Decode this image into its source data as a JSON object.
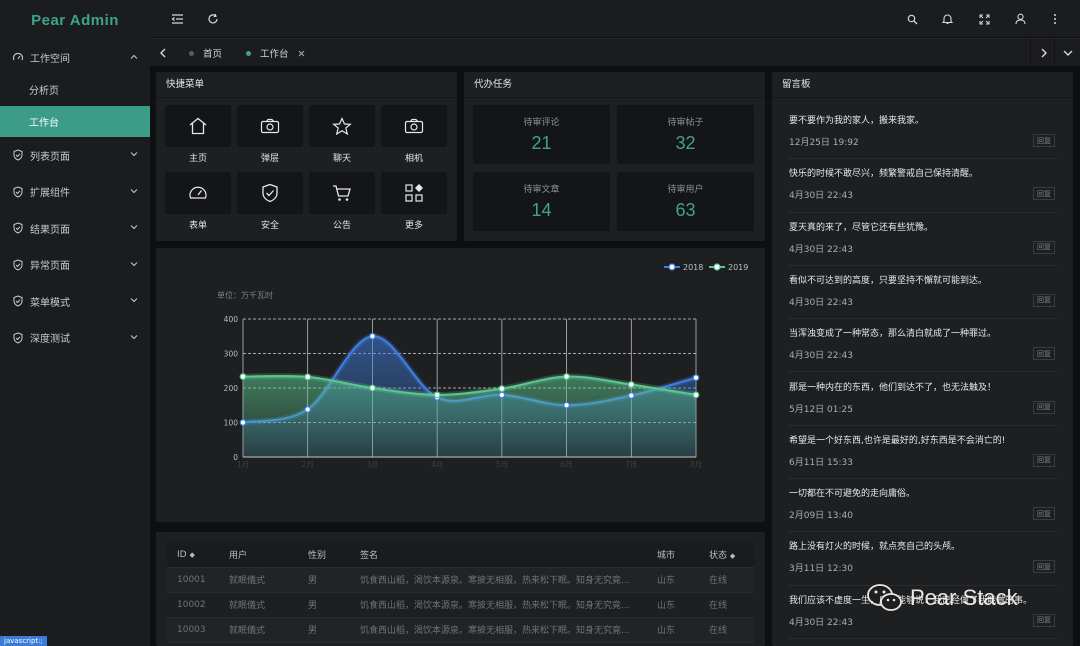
{
  "app": {
    "title": "Pear Admin"
  },
  "sidebar": {
    "items": [
      {
        "label": "工作空间",
        "icon": "dashboard-icon",
        "expanded": true
      },
      {
        "label": "分析页"
      },
      {
        "label": "工作台",
        "active": true
      },
      {
        "label": "列表页面",
        "icon": "shield-check-icon"
      },
      {
        "label": "扩展组件",
        "icon": "shield-check-icon"
      },
      {
        "label": "结果页面",
        "icon": "shield-check-icon"
      },
      {
        "label": "异常页面",
        "icon": "shield-check-icon"
      },
      {
        "label": "菜单模式",
        "icon": "shield-check-icon"
      },
      {
        "label": "深度测试",
        "icon": "shield-check-icon"
      }
    ]
  },
  "topbar": {
    "icons": [
      "menu-collapse-icon",
      "refresh-icon",
      "search-icon",
      "bell-icon",
      "fullscreen-icon",
      "user-icon",
      "more-icon"
    ]
  },
  "tabs": [
    {
      "label": "首页",
      "dot_color": "#5a5c60"
    },
    {
      "label": "工作台",
      "dot_color": "#3fa38c",
      "closable": true
    }
  ],
  "quick_menu": {
    "title": "快捷菜单",
    "items": [
      {
        "label": "主页",
        "icon": "home-icon"
      },
      {
        "label": "弹层",
        "icon": "camera-icon"
      },
      {
        "label": "聊天",
        "icon": "star-icon"
      },
      {
        "label": "相机",
        "icon": "camera-icon"
      },
      {
        "label": "表单",
        "icon": "gauge-icon"
      },
      {
        "label": "安全",
        "icon": "shield-check-icon"
      },
      {
        "label": "公告",
        "icon": "cart-icon"
      },
      {
        "label": "更多",
        "icon": "apps-icon"
      }
    ]
  },
  "todo": {
    "title": "代办任务",
    "items": [
      {
        "label": "待审评论",
        "value": "21"
      },
      {
        "label": "待审帖子",
        "value": "32"
      },
      {
        "label": "待审文章",
        "value": "14"
      },
      {
        "label": "待审用户",
        "value": "63"
      }
    ]
  },
  "messages": {
    "title": "留言板",
    "reply_label": "回复",
    "items": [
      {
        "text": "要不要作为我的家人，搬来我家。",
        "time": "12月25日 19:92"
      },
      {
        "text": "快乐的时候不敢尽兴，频繁警戒自己保持清醒。",
        "time": "4月30日 22:43"
      },
      {
        "text": "夏天真的来了，尽管它还有些犹豫。",
        "time": "4月30日 22:43"
      },
      {
        "text": "看似不可达到的高度，只要坚持不懈就可能到达。",
        "time": "4月30日 22:43"
      },
      {
        "text": "当浑浊变成了一种常态，那么清白就成了一种罪过。",
        "time": "4月30日 22:43"
      },
      {
        "text": "那是一种内在的东西，他们到达不了，也无法触及！",
        "time": "5月12日 01:25"
      },
      {
        "text": "希望是一个好东西,也许是最好的,好东西是不会消亡的!",
        "time": "6月11日 15:33"
      },
      {
        "text": "一切都在不可避免的走向庸俗。",
        "time": "2月09日 13:40"
      },
      {
        "text": "路上没有灯火的时候，就点亮自己的头颅。",
        "time": "3月11日 12:30"
      },
      {
        "text": "我们应该不虚度一生，应该能够说：我已经做了我能做的事。",
        "time": "4月30日 22:43"
      }
    ]
  },
  "chart_data": {
    "type": "area",
    "unit_label": "单位：万千瓦时",
    "categories": [
      "1月",
      "2月",
      "3月",
      "4月",
      "5月",
      "6月",
      "7月",
      "8月"
    ],
    "ylim": [
      0,
      400
    ],
    "yticks": [
      0,
      100,
      200,
      300,
      400
    ],
    "legend_position": "top-right",
    "series": [
      {
        "name": "2018",
        "color": "#3f7de0",
        "values": [
          100,
          138,
          350,
          173,
          180,
          150,
          178,
          230
        ]
      },
      {
        "name": "2019",
        "color": "#5ac58e",
        "values": [
          233,
          232,
          200,
          180,
          198,
          233,
          210,
          180
        ]
      }
    ]
  },
  "table": {
    "columns": [
      "ID",
      "用户",
      "性别",
      "签名",
      "城市",
      "状态"
    ],
    "rows": [
      [
        "10001",
        "就眠儀式",
        "男",
        "饥食西山稻，渴饮本源泉。寒披无相服，热来松下眠。知身无究竟...",
        "山东",
        "在线"
      ],
      [
        "10002",
        "就眠儀式",
        "男",
        "饥食西山稻，渴饮本源泉。寒披无相服，热来松下眠。知身无究竟...",
        "山东",
        "在线"
      ],
      [
        "10003",
        "就眠儀式",
        "男",
        "饥食西山稻，渴饮本源泉。寒披无相服，热来松下眠。知身无究竟...",
        "山东",
        "在线"
      ]
    ]
  },
  "statusbar": {
    "text": "javascript:;"
  },
  "watermark": {
    "text": "Pear Stack"
  }
}
